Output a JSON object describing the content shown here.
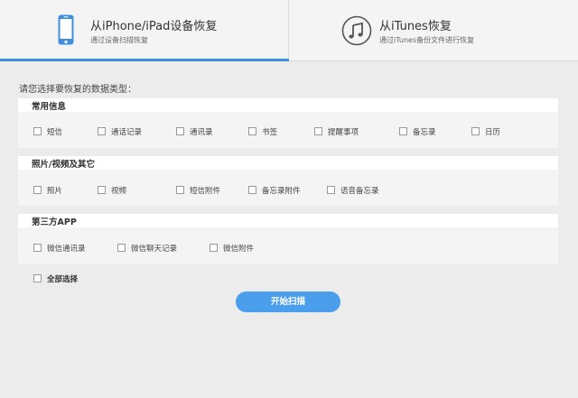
{
  "tabs": {
    "ios": {
      "title": "从iPhone/iPad设备恢复",
      "subtitle": "通过设备扫描恢复",
      "icon": "iphone-icon"
    },
    "itunes": {
      "title": "从iTunes恢复",
      "subtitle": "通过iTunes备份文件进行恢复",
      "icon": "music-note-icon"
    }
  },
  "prompt": "请您选择要恢复的数据类型：",
  "sections": {
    "common": {
      "title": "常用信息",
      "options": [
        "短信",
        "通话记录",
        "通讯录",
        "书签",
        "提醒事项",
        "备忘录",
        "日历"
      ]
    },
    "media": {
      "title": "照片/视频及其它",
      "options": [
        "照片",
        "视频",
        "短信附件",
        "备忘录附件",
        "语音备忘录"
      ]
    },
    "thirdparty": {
      "title": "第三方APP",
      "options": [
        "微信通讯录",
        "微信聊天记录",
        "微信附件"
      ]
    }
  },
  "select_all": "全部选择",
  "start_button": "开始扫描",
  "colors": {
    "accent": "#3f8fe0",
    "button": "#4a9eec"
  }
}
